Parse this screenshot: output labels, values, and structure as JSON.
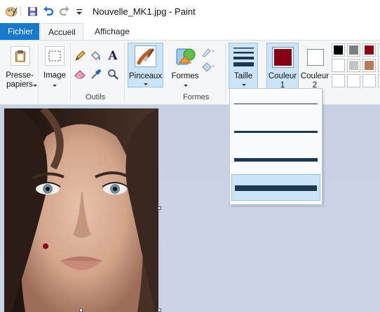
{
  "window": {
    "title": "Nouvelle_MK1.jpg - Paint"
  },
  "tabs": {
    "file": "Fichier",
    "home": "Accueil",
    "view": "Affichage"
  },
  "ribbon": {
    "clipboard": {
      "label_line1": "Presse-",
      "label_line2": "papiers"
    },
    "image": {
      "label": "Image"
    },
    "tools_group_label": "Outils",
    "brushes": {
      "label": "Pinceaux"
    },
    "shapes": {
      "label": "Formes",
      "group_label": "Formes"
    },
    "size": {
      "label": "Taille"
    },
    "color1": {
      "label_line1": "Couleur",
      "label_line2": "1",
      "color": "#880015"
    },
    "color2": {
      "label_line1": "Couleur",
      "label_line2": "2",
      "color": "#ffffff"
    }
  },
  "palette": {
    "row1": [
      "#000000",
      "#7f7f7f",
      "#880015",
      "#ed1c24"
    ],
    "row2": [
      "#ffffff",
      "#c3c3c3",
      "#b97a57",
      "#ffaec9"
    ]
  },
  "size_dropdown": {
    "options": [
      {
        "thickness_px": 1
      },
      {
        "thickness_px": 3
      },
      {
        "thickness_px": 5
      },
      {
        "thickness_px": 8
      }
    ],
    "selected_index": 3
  },
  "canvas": {
    "image_subject": "portrait-photo",
    "brush_dot_color": "#8b0012"
  },
  "colors": {
    "accent": "#1979ca",
    "selection": "#cce4f7",
    "size_line": "#1d3652"
  }
}
